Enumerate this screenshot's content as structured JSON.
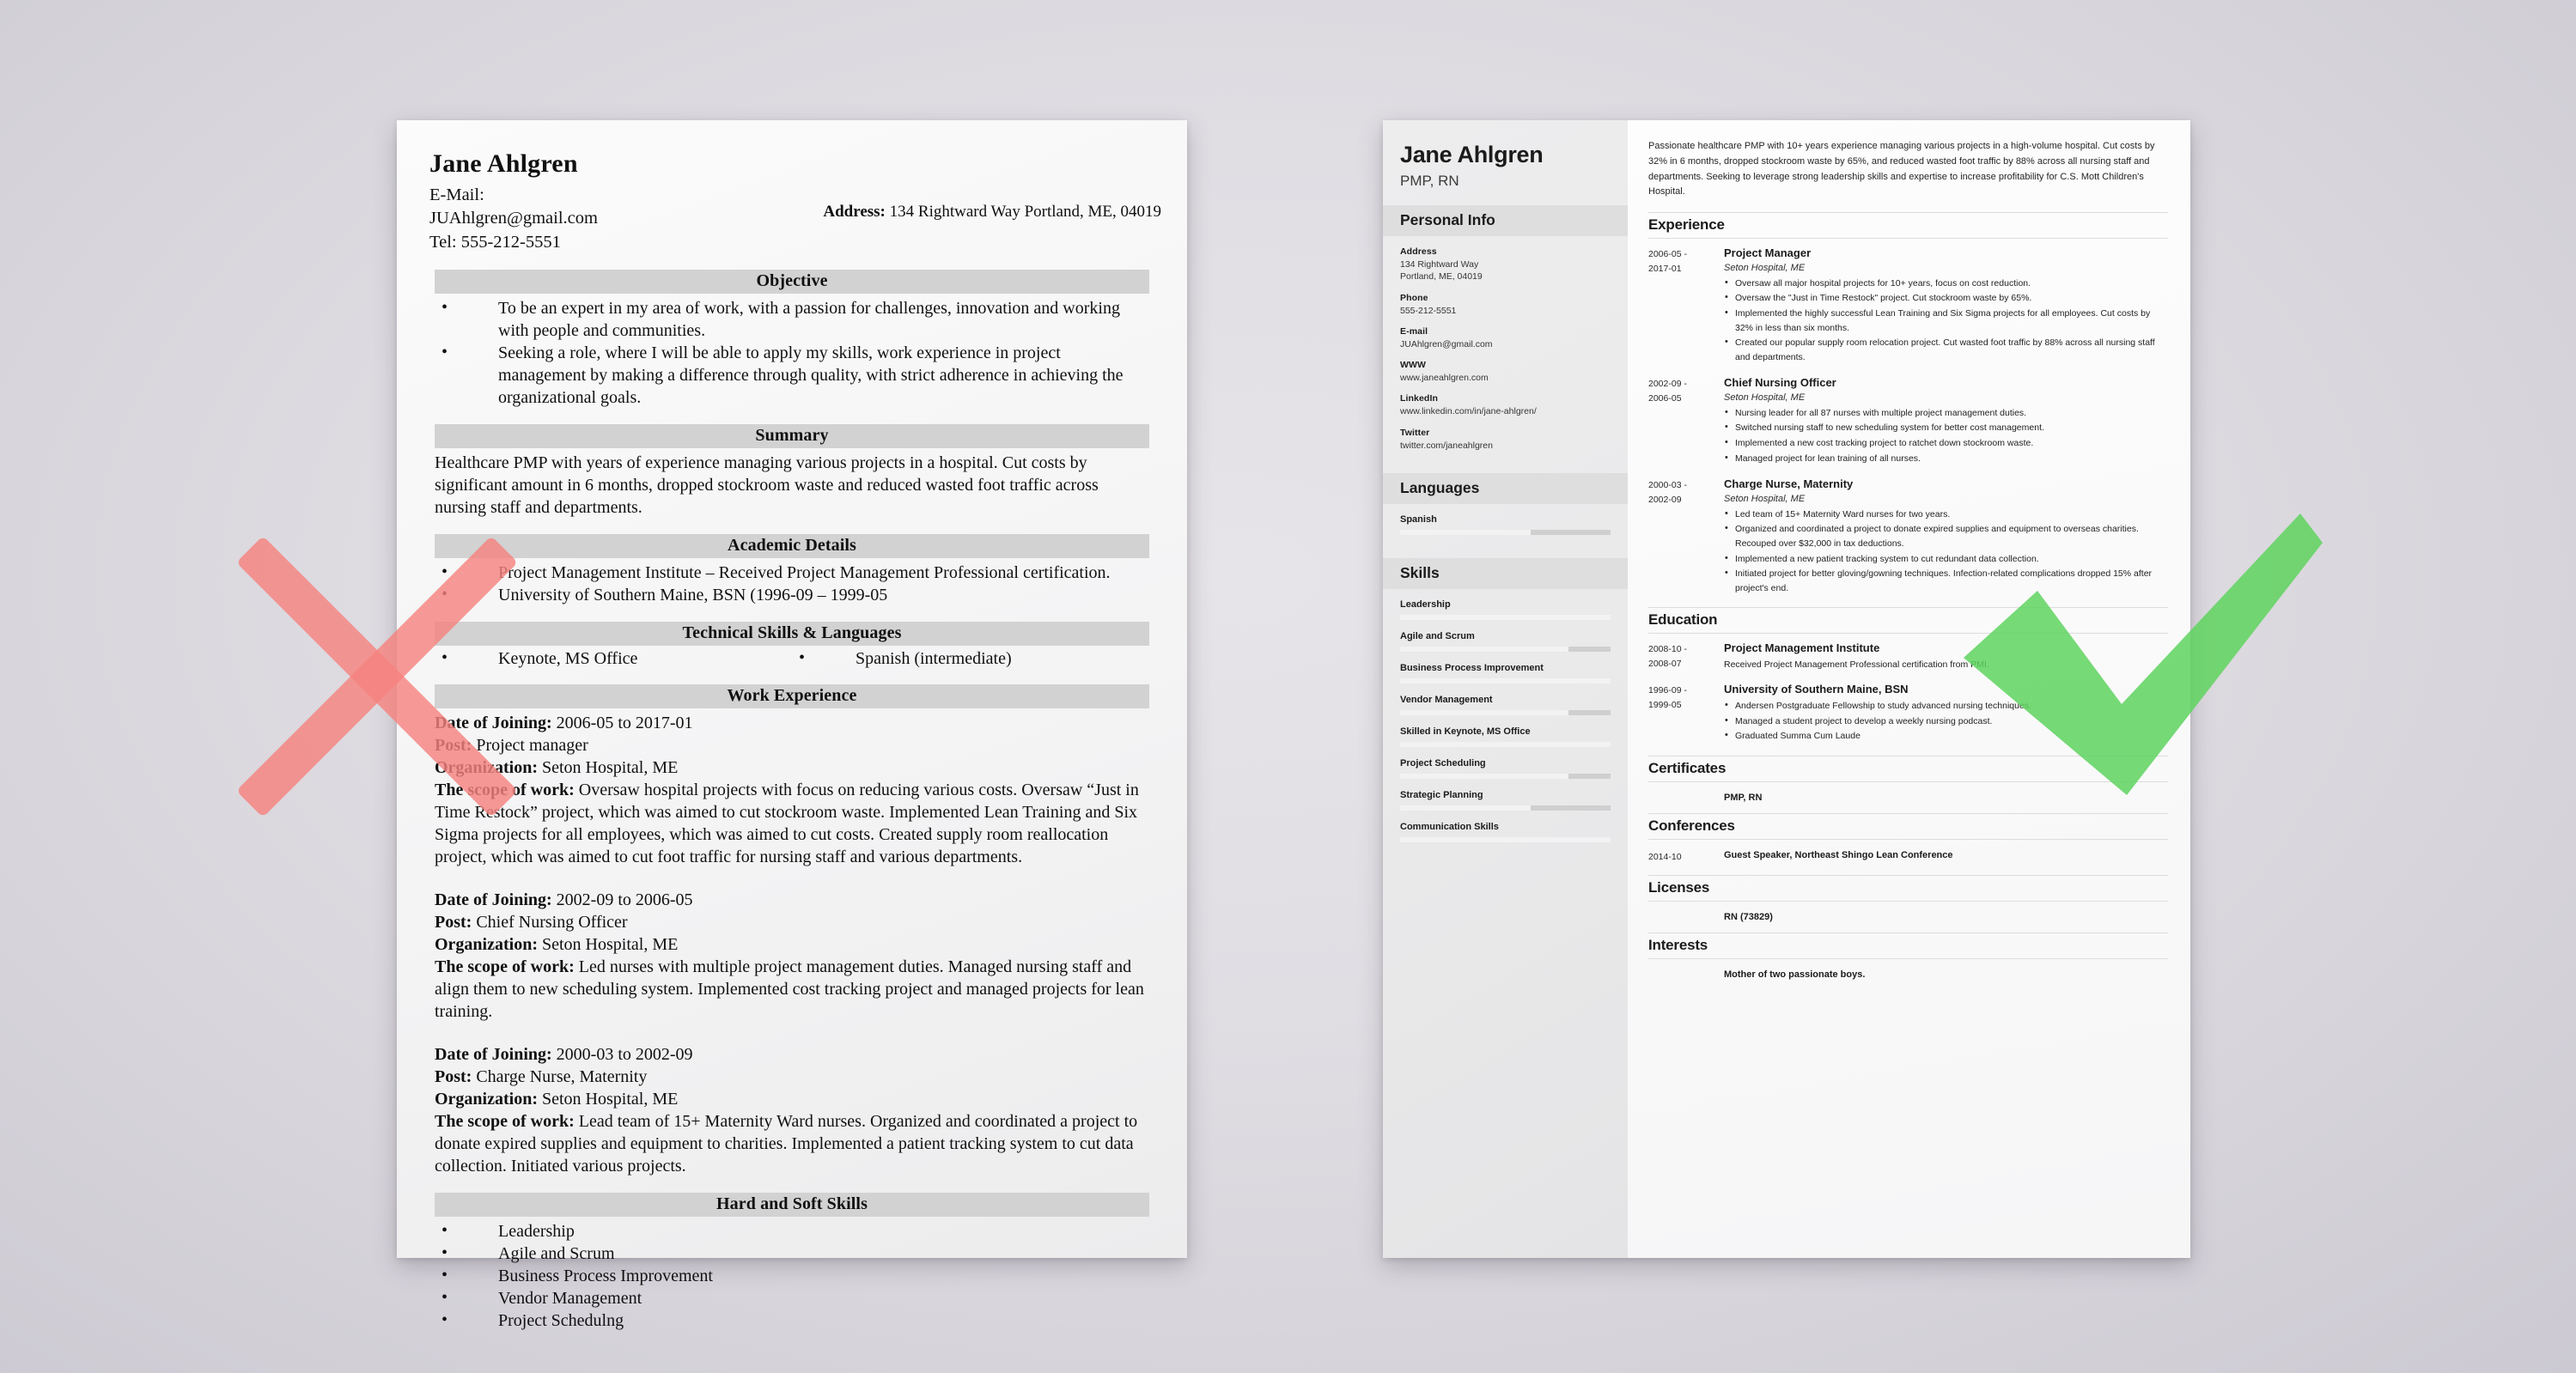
{
  "marks": {
    "reject_icon": "x-mark",
    "accept_icon": "check-mark",
    "reject_color": "#f5827f",
    "accept_color": "#5ed45e"
  },
  "bad_resume": {
    "name": "Jane Ahlgren",
    "email_line": "E-Mail: JUAhlgren@gmail.com",
    "tel_line": "Tel: 555-212-5551",
    "address_label": "Address:",
    "address_value": "134 Rightward Way Portland, ME, 04019",
    "sections": {
      "objective": {
        "heading": "Objective",
        "bullets": [
          "To be an expert in my area of work, with a passion for challenges, innovation and working with people and communities.",
          "Seeking a role, where I will be able to apply my skills, work experience in project management by making a difference through quality, with strict adherence in achieving the organizational goals."
        ]
      },
      "summary": {
        "heading": "Summary",
        "text": "Healthcare PMP with years of experience managing various projects in a hospital. Cut costs by significant amount in 6 months, dropped stockroom waste and reduced wasted foot traffic across nursing staff and departments."
      },
      "academic": {
        "heading": "Academic Details",
        "bullets": [
          "Project Management Institute – Received Project Management Professional certification.",
          "University of Southern Maine, BSN (1996-09 – 1999-05"
        ]
      },
      "technical": {
        "heading": "Technical Skills & Languages",
        "left": "Keynote, MS Office",
        "right": "Spanish (intermediate)"
      },
      "work": {
        "heading": "Work Experience",
        "jobs": [
          {
            "date_label": "Date of Joining:",
            "date_value": " 2006-05 to 2017-01",
            "post_label": "Post:",
            "post_value": " Project manager",
            "org_label": "Organization:",
            "org_value": " Seton Hospital, ME",
            "scope_label": "The scope of work:",
            "scope_value": " Oversaw hospital projects with focus on reducing various costs. Oversaw “Just in Time Restock” project, which was aimed to cut stockroom waste. Implemented Lean Training and Six Sigma projects for all employees, which was aimed to cut costs. Created supply room reallocation project, which was aimed to cut foot traffic for nursing staff and various departments."
          },
          {
            "date_label": "Date of Joining:",
            "date_value": " 2002-09 to 2006-05",
            "post_label": "Post:",
            "post_value": " Chief Nursing Officer",
            "org_label": "Organization:",
            "org_value": " Seton Hospital, ME",
            "scope_label": "The scope of work:",
            "scope_value": " Led nurses with multiple project management duties. Managed nursing staff and align them to new scheduling system. Implemented cost tracking project and managed projects for lean training."
          },
          {
            "date_label": "Date of Joining:",
            "date_value": " 2000-03 to 2002-09",
            "post_label": "Post:",
            "post_value": " Charge Nurse, Maternity",
            "org_label": "Organization:",
            "org_value": " Seton Hospital, ME",
            "scope_label": "The scope of work:",
            "scope_value": " Lead team of 15+ Maternity Ward nurses. Organized and coordinated a project to donate expired supplies and equipment to charities. Implemented a patient tracking system to cut data collection. Initiated various projects."
          }
        ]
      },
      "skills": {
        "heading": "Hard and Soft Skills",
        "items": [
          "Leadership",
          "Agile and Scrum",
          "Business Process Improvement",
          "Vendor Management",
          "Project Schedulng"
        ]
      }
    }
  },
  "good_resume": {
    "sidebar": {
      "name": "Jane Ahlgren",
      "title": "PMP, RN",
      "personal_info_heading": "Personal Info",
      "fields": [
        {
          "label": "Address",
          "value": "134 Rightward Way\nPortland, ME, 04019"
        },
        {
          "label": "Phone",
          "value": "555-212-5551"
        },
        {
          "label": "E-mail",
          "value": "JUAhlgren@gmail.com"
        },
        {
          "label": "WWW",
          "value": "www.janeahlgren.com"
        },
        {
          "label": "LinkedIn",
          "value": "www.linkedin.com/in/jane-ahlgren/"
        },
        {
          "label": "Twitter",
          "value": "twitter.com/janeahlgren"
        }
      ],
      "languages_heading": "Languages",
      "languages": [
        {
          "name": "Spanish",
          "level": 62
        }
      ],
      "skills_heading": "Skills",
      "skills": [
        {
          "name": "Leadership",
          "level": 100
        },
        {
          "name": "Agile and Scrum",
          "level": 80
        },
        {
          "name": "Business Process Improvement",
          "level": 100
        },
        {
          "name": "Vendor Management",
          "level": 80
        },
        {
          "name": "Skilled in Keynote, MS Office",
          "level": 100
        },
        {
          "name": "Project Scheduling",
          "level": 80
        },
        {
          "name": "Strategic Planning",
          "level": 62
        },
        {
          "name": "Communication Skills",
          "level": 100
        }
      ]
    },
    "main": {
      "summary": "Passionate healthcare PMP with 10+ years experience managing various projects in a high-volume hospital. Cut costs by 32% in 6 months, dropped stockroom waste by 65%, and reduced wasted foot traffic by 88% across all nursing staff and departments. Seeking to leverage strong leadership skills and expertise to increase profitability for C.S. Mott Children's Hospital.",
      "experience": {
        "heading": "Experience",
        "entries": [
          {
            "date": "2006-05 -\n2017-01",
            "role": "Project Manager",
            "org": "Seton Hospital, ME",
            "bullets": [
              "Oversaw all major hospital projects for 10+ years, focus on cost reduction.",
              "Oversaw the \"Just in Time Restock\" project. Cut stockroom waste by 65%.",
              "Implemented the highly successful Lean Training and Six Sigma projects for all employees. Cut costs by 32% in less than six months.",
              "Created our popular supply room relocation project. Cut wasted foot traffic by 88% across all nursing staff and departments."
            ]
          },
          {
            "date": "2002-09 -\n2006-05",
            "role": "Chief Nursing Officer",
            "org": "Seton Hospital, ME",
            "bullets": [
              "Nursing leader for all 87 nurses with multiple project management duties.",
              "Switched nursing staff to new scheduling system for better cost management.",
              "Implemented a new cost tracking project to ratchet down stockroom waste.",
              "Managed project for lean training of all nurses."
            ]
          },
          {
            "date": "2000-03 -\n2002-09",
            "role": "Charge Nurse, Maternity",
            "org": "Seton Hospital, ME",
            "bullets": [
              "Led team of 15+ Maternity Ward nurses for two years.",
              "Organized and coordinated a project to donate expired supplies and equipment to overseas charities. Recouped over $32,000 in tax deductions.",
              "Implemented a new patient tracking system to cut redundant data collection.",
              "Initiated project for better gloving/gowning techniques. Infection-related complications dropped 15% after project's end."
            ]
          }
        ]
      },
      "education": {
        "heading": "Education",
        "entries": [
          {
            "date": "2008-10 -\n2008-07",
            "role": "Project Management Institute",
            "text": "Received Project Management Professional certification from PMI.",
            "bullets": []
          },
          {
            "date": "1996-09 -\n1999-05",
            "role": "University of Southern Maine, BSN",
            "text": "",
            "bullets": [
              "Andersen Postgraduate Fellowship to study advanced nursing techniques.",
              "Managed a student project to develop a weekly nursing podcast.",
              "Graduated Summa Cum Laude"
            ]
          }
        ]
      },
      "certificates": {
        "heading": "Certificates",
        "date": "",
        "value": "PMP, RN"
      },
      "conferences": {
        "heading": "Conferences",
        "date": "2014-10",
        "value": "Guest Speaker, Northeast Shingo Lean Conference"
      },
      "licenses": {
        "heading": "Licenses",
        "date": "",
        "value": "RN (73829)"
      },
      "interests": {
        "heading": "Interests",
        "date": "",
        "value": "Mother of two passionate boys."
      }
    }
  }
}
